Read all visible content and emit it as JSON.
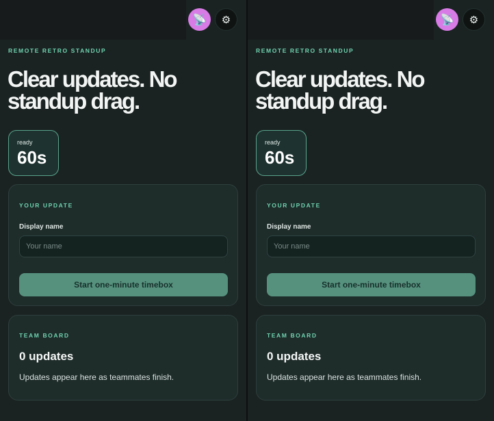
{
  "header": {
    "avatar_icon": "satellite-dish-icon",
    "avatar_glyph": "📡",
    "settings_icon": "gear-icon",
    "settings_glyph": "⚙"
  },
  "eyebrow": "REMOTE RETRO STANDUP",
  "hero": "Clear updates. No standup drag.",
  "timer": {
    "status": "ready",
    "value": "60s"
  },
  "your_update": {
    "heading": "YOUR UPDATE",
    "display_name_label": "Display name",
    "display_name_value": "",
    "display_name_placeholder": "Your name",
    "start_button_label": "Start one-minute timebox"
  },
  "team_board": {
    "heading": "TEAM BOARD",
    "count_text": "0 updates",
    "empty_note": "Updates appear here as teammates finish."
  },
  "colors": {
    "accent": "#6fd3b0",
    "button": "#56917e",
    "avatar": "#d87be6",
    "background": "#1a2322"
  }
}
